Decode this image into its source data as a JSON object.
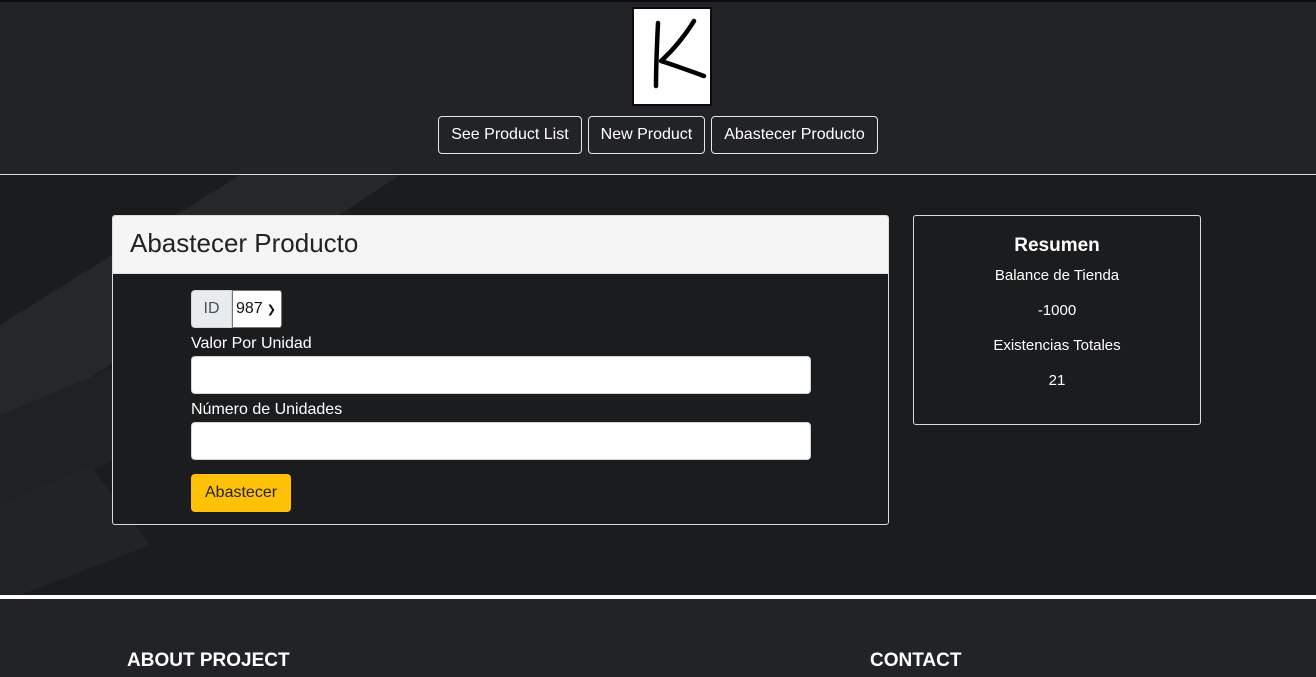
{
  "header": {
    "logo_letter": "K",
    "nav": [
      {
        "label": "See Product List"
      },
      {
        "label": "New Product"
      },
      {
        "label": "Abastecer Producto"
      }
    ]
  },
  "form": {
    "title": "Abastecer Producto",
    "id_label": "ID",
    "id_selected": "987",
    "valor_label": "Valor Por Unidad",
    "valor_value": "",
    "unidades_label": "Número de Unidades",
    "unidades_value": "",
    "submit_label": "Abastecer"
  },
  "summary": {
    "title": "Resumen",
    "balance_label": "Balance de Tienda",
    "balance_value": "-1000",
    "existencias_label": "Existencias Totales",
    "existencias_value": "21"
  },
  "footer": {
    "about_heading": "ABOUT PROJECT",
    "contact_heading": "CONTACT"
  },
  "colors": {
    "background": "#222327",
    "main_background": "#1b1c1e",
    "accent": "#ffc107"
  }
}
